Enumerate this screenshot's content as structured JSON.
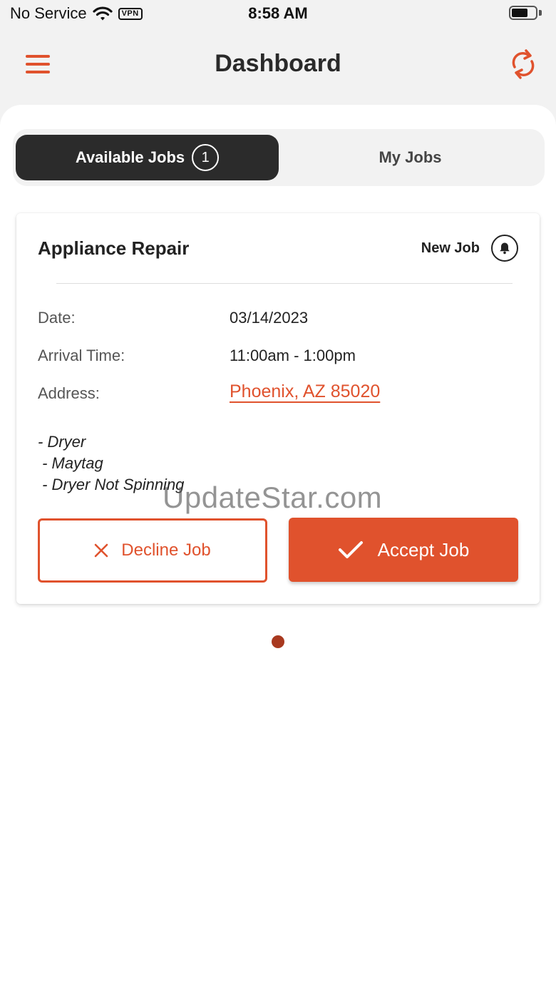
{
  "status_bar": {
    "carrier": "No Service",
    "vpn": "VPN",
    "time": "8:58 AM"
  },
  "header": {
    "title": "Dashboard",
    "menu_icon": "hamburger-menu-icon",
    "refresh_icon": "refresh-icon"
  },
  "tabs": [
    {
      "label": "Available Jobs",
      "count": "1",
      "active": true
    },
    {
      "label": "My Jobs",
      "active": false
    }
  ],
  "job": {
    "title": "Appliance Repair",
    "status": "New Job",
    "status_icon": "bell-icon",
    "details": [
      {
        "label": "Date:",
        "value": "03/14/2023"
      },
      {
        "label": "Arrival Time:",
        "value": "11:00am - 1:00pm"
      },
      {
        "label": "Address:",
        "value": "Phoenix, AZ 85020"
      }
    ],
    "notes": "- Dryer\n - Maytag\n - Dryer Not Spinning",
    "decline_label": "Decline Job",
    "accept_label": "Accept Job"
  },
  "watermark": "UpdateStar.com",
  "pagination": {
    "current": 1,
    "total": 1
  },
  "colors": {
    "accent": "#e0522d",
    "dark_tab": "#2b2b2b",
    "page_dot": "#a8391f"
  }
}
